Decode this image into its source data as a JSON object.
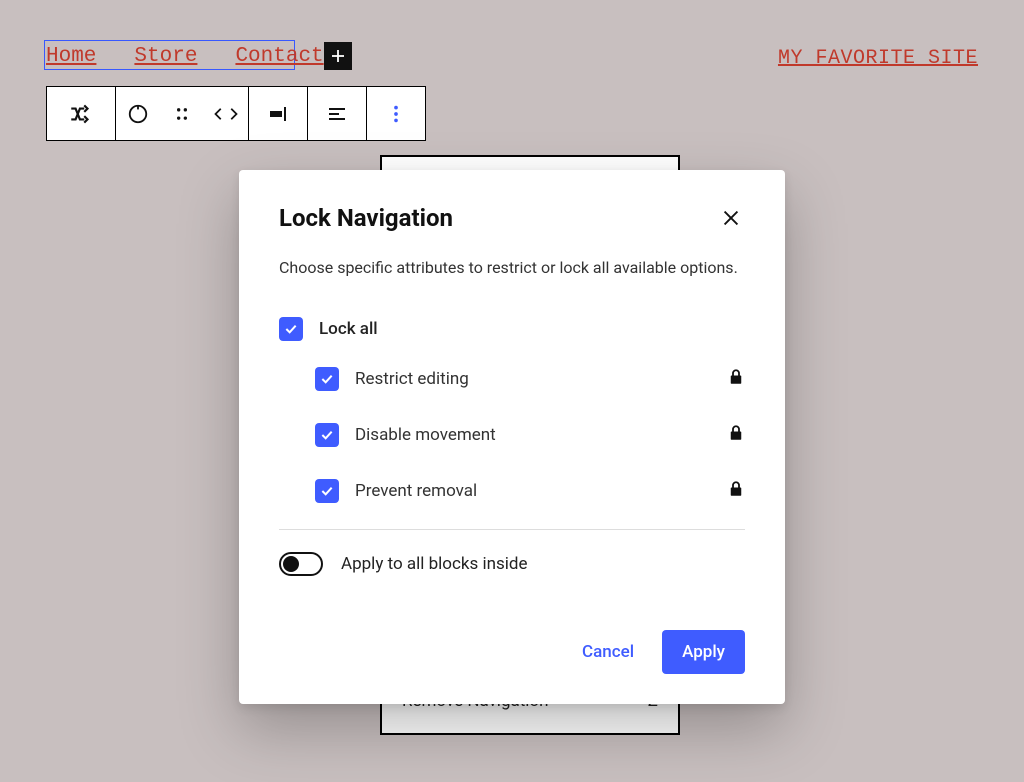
{
  "nav": {
    "items": [
      "Home",
      "Store",
      "Contact"
    ]
  },
  "site_title": "MY FAVORITE SITE",
  "dropdown": {
    "visible_item_label": "Remove Navigation",
    "visible_item_shortcut": "⌃Z"
  },
  "modal": {
    "title": "Lock Navigation",
    "description": "Choose specific attributes to restrict or lock all available options.",
    "lock_all_label": "Lock all",
    "options": [
      {
        "label": "Restrict editing"
      },
      {
        "label": "Disable movement"
      },
      {
        "label": "Prevent removal"
      }
    ],
    "apply_inside_label": "Apply to all blocks inside",
    "cancel_label": "Cancel",
    "apply_label": "Apply"
  }
}
